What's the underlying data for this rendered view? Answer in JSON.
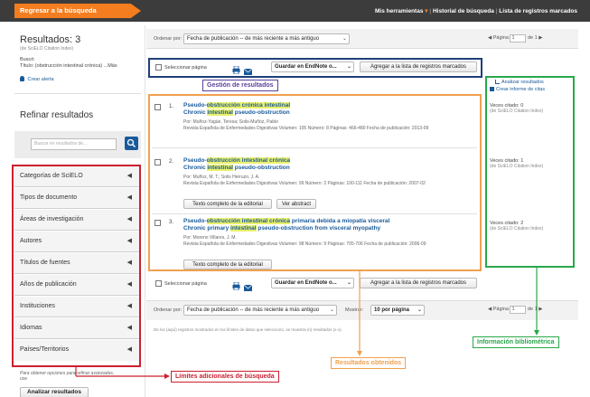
{
  "topbar": {
    "back_link": "Regresar a la búsqueda",
    "my_tools": "Mis herramientas",
    "my_tools_arrow": "▾",
    "history": "Historial de búsqueda",
    "marked_list": "Lista de registros marcados"
  },
  "sidebar": {
    "results_title": "Resultados: 3",
    "results_source": "(de SciELO Citation Index)",
    "searched_label": "Buscó:",
    "searched_query": "Título: (obstrucción intestinal crónica) ...Más",
    "create_alert": "Crear alerta",
    "refine_title": "Refinar resultados",
    "search_placeholder": "Buscar en resultados de...",
    "facets": [
      "Categorías de SciELO",
      "Tipos de documento",
      "Áreas de investigación",
      "Autores",
      "Títulos de fuentes",
      "Años de publicación",
      "Instituciones",
      "Idiomas",
      "Países/Territorios"
    ],
    "footer_note": "Para obtener opciones para refinar avanzadas, use",
    "analyze_button": "Analizar resultados"
  },
  "controls": {
    "sort_label": "Ordenar por:",
    "sort_value": "Fecha de publicación -- de más reciente a más antiguo",
    "page_label": "Página",
    "page_value": "1",
    "page_total": "de 1",
    "select_page": "Seleccionar página",
    "save_endnote": "Guardar en EndNote o...",
    "add_marked": "Agregar a la lista de registros marcados",
    "show_label": "Mostrar:",
    "show_value": "10 por página",
    "footnote": "De los (aquí) registros mostrados en los límites de datos que seleccionó, se muestra (n) resultados (x-x)."
  },
  "right_panel": {
    "analyze_link": "Analizar resultados",
    "citation_report": "Crear informe de citas",
    "citations": [
      {
        "label": "Veces citado: 0",
        "source": "(de SciELO Citation Index)"
      },
      {
        "label": "Veces citado: 1",
        "source": "(de SciELO Citation Index)"
      },
      {
        "label": "Veces citado: 2",
        "source": "(de SciELO Citation Index)"
      }
    ]
  },
  "results": [
    {
      "num": "1.",
      "title_pre": "Pseudo-",
      "title_hl1": "obstrucción crónica intestinal",
      "title_post": "",
      "title2_pre": "Chronic ",
      "title2_hl": "intestinal",
      "title2_post": " pseudo-obstruction",
      "authors": "Por: Muñoz-Yagüe, Teresa; Solis-Muñoz, Pablo",
      "journal": "Revista Española de Enfermedades Digestivas  Volumen: 105  Número: 8  Páginas: 466-480  Fecha de publicación: 2013-09",
      "buttons": []
    },
    {
      "num": "2.",
      "title_pre": "Pseudo-",
      "title_hl1": "obstrucción intestinal crónica",
      "title_post": "",
      "title2_pre": "Chronic ",
      "title2_hl": "intestinal",
      "title2_post": " pseudo-obstruction",
      "authors": "Por: Muñoz, M. T.; Solis Herruzo, J. A.",
      "journal": "Revista Española de Enfermedades Digestivas  Volumen: 99  Número: 2  Páginas: 100-111  Fecha de publicación: 2007-02",
      "buttons": [
        "Texto completo de la editorial",
        "Ver abstract"
      ]
    },
    {
      "num": "3.",
      "title_pre": "Pseudo-",
      "title_hl1": "obstrucción intestinal crónica",
      "title_post": " primaria debida a miopatía visceral",
      "title2_pre": "Chronic primary ",
      "title2_hl": "intestinal",
      "title2_post": " pseudo-obstruction from visceral myopathy",
      "authors": "Por: Moreno Villares, J. M.",
      "journal": "Revista Española de Enfermedades Digestivas  Volumen: 98  Número: 9  Páginas: 705-706  Fecha de publicación: 2006-09",
      "buttons": [
        "Texto completo de la editorial"
      ]
    }
  ],
  "annotations": {
    "gestion": "Gestión de resultados",
    "limites": "Límites adicionales de búsqueda",
    "obtenidos": "Resultados obtenidos",
    "bibliometrica": "Información bibliométrica",
    "colors": {
      "purple": "#5a3e9b",
      "red": "#cc1f2f",
      "orange": "#f0a050",
      "green": "#29a84a",
      "blue_box": "#1f3f7a"
    }
  },
  "colors": {
    "topbar": "#3c3c3c",
    "back_link_bg": "#f47d20",
    "link_blue": "#1a5a9a",
    "highlight": "#e9f06b"
  }
}
